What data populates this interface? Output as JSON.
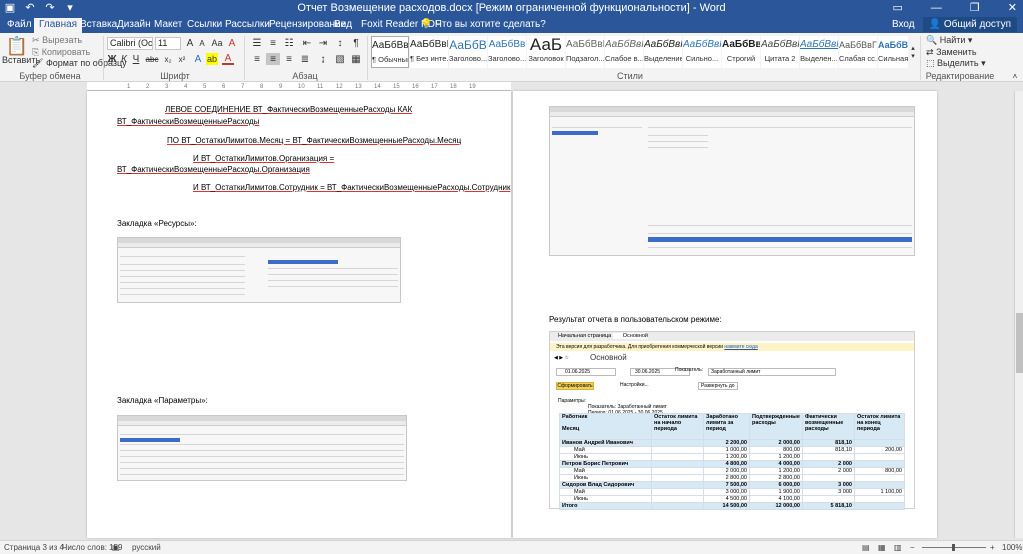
{
  "window": {
    "title": "Отчет Возмещение расходов.docx [Режим ограниченной функциональности] - Word",
    "minimize": "—",
    "restore": "❐",
    "close": "✕"
  },
  "qat": {
    "save_icon": "save-icon",
    "undo_icon": "undo-icon",
    "redo_icon": "redo-icon",
    "customize_icon": "customize-icon"
  },
  "tabs": [
    "Файл",
    "Главная",
    "Вставка",
    "Дизайн",
    "Макет",
    "Ссылки",
    "Рассылки",
    "Рецензирование",
    "Вид",
    "Foxit Reader PDF"
  ],
  "active_tab": "Главная",
  "tell_me": "Что вы хотите сделать?",
  "account": {
    "signin": "Вход",
    "share": "Общий доступ"
  },
  "ribbon": {
    "clipboard": {
      "paste": "Вставить",
      "cut": "Вырезать",
      "copy": "Копировать",
      "format_painter": "Формат по образцу",
      "label": "Буфер обмена"
    },
    "font": {
      "name": "Calibri (Осн",
      "size": "11",
      "label": "Шрифт",
      "bold": "Ж",
      "italic": "К",
      "underline": "Ч",
      "strike": "abc",
      "sub": "x₂",
      "sup": "x²",
      "grow": "A",
      "shrink": "A",
      "case": "Аа",
      "clear": "A"
    },
    "paragraph": {
      "label": "Абзац",
      "pilcrow": "¶"
    },
    "styles": {
      "label": "Стили",
      "items": [
        {
          "preview": "АаБбВвГг,",
          "name": "¶ Обычный"
        },
        {
          "preview": "АаБбВвГг,",
          "name": "¶ Без инте..."
        },
        {
          "preview": "АаБбВ",
          "name": "Заголово..."
        },
        {
          "preview": "АаБбВв",
          "name": "Заголово..."
        },
        {
          "preview": "АаБ",
          "name": "Заголовок"
        },
        {
          "preview": "АаБбВвГ",
          "name": "Подзагол..."
        },
        {
          "preview": "АаБбВвГг",
          "name": "Слабое в..."
        },
        {
          "preview": "АаБбВвГг",
          "name": "Выделение"
        },
        {
          "preview": "АаБбВвГг",
          "name": "Сильно..."
        },
        {
          "preview": "АаБбВвГг",
          "name": "Строгий"
        },
        {
          "preview": "АаБбВвГг",
          "name": "Цитата 2"
        },
        {
          "preview": "АаБбВвГг",
          "name": "Выделен..."
        },
        {
          "preview": "АаБбВвГг",
          "name": "Слабая сс..."
        },
        {
          "preview": "АаБбВвГг",
          "name": "Сильная..."
        }
      ]
    },
    "editing": {
      "find": "Найти",
      "replace": "Заменить",
      "select": "Выделить",
      "label": "Редактирование"
    }
  },
  "ruler_ticks": [
    "1",
    "2",
    "3",
    "4",
    "5",
    "6",
    "7",
    "8",
    "9",
    "10",
    "11",
    "12",
    "13",
    "14",
    "15",
    "16",
    "17",
    "18",
    "19"
  ],
  "left_page": {
    "lines": [
      "ЛЕВОЕ СОЕДИНЕНИЕ ВТ_ФактическиВозмещенныеРасходы КАК",
      "ВТ_ФактическиВозмещенныеРасходы",
      "ПО ВТ_ОстаткиЛимитов.Месяц = ВТ_ФактическиВозмещенныеРасходы.Месяц",
      "И ВТ_ОстаткиЛимитов.Организация =",
      "ВТ_ФактическиВозмещенныеРасходы.Организация",
      "И ВТ_ОстаткиЛимитов.Сотрудник = ВТ_ФактическиВозмещенныеРасходы.Сотрудник"
    ],
    "heading_resources": "Закладка «Ресурсы»:",
    "heading_params": "Закладка «Параметры»:"
  },
  "right_page": {
    "result_heading": "Результат отчета в пользовательском режиме:",
    "report": {
      "tab_home": "Начальная страница",
      "tab_main": "Основной",
      "notice": "Эта версия для разработчика. Для приобретения коммерческой версии",
      "notice_link": "нажмите сюда",
      "title": "Основной",
      "date_from": "01.06.2025",
      "date_to": "30.06.2025",
      "show_label": "Показатель:",
      "show_value": "Заработанный лимит",
      "generate_btn": "Сформировать",
      "settings_btn": "Настройки...",
      "expand_btn": "Развернуть до",
      "params_label": "Параметры:",
      "params_line1": "Показатель: Заработанный лимит",
      "params_line2": "Период: 01.06.2025 - 30.06.2025",
      "headers": [
        "Работник",
        "Остаток лимита на начало периода",
        "Заработано лимита за период",
        "Подтвержденные расходы",
        "Фактически возмещенные расходы",
        "Остаток лимита на конец периода"
      ],
      "header_sub": "Месяц",
      "rows": [
        {
          "type": "grp",
          "cells": [
            "Иванов Андрей Иванович",
            "",
            "2 200,00",
            "2 000,00",
            "818,10",
            ""
          ]
        },
        {
          "type": "row",
          "cells": [
            "Май",
            "",
            "1 000,00",
            "800,00",
            "818,10",
            "200,00"
          ]
        },
        {
          "type": "row",
          "cells": [
            "Июнь",
            "",
            "1 200,00",
            "1 200,00",
            "",
            ""
          ]
        },
        {
          "type": "grp",
          "cells": [
            "Петров Борис Петрович",
            "",
            "4 800,00",
            "4 000,00",
            "2 000",
            ""
          ]
        },
        {
          "type": "row",
          "cells": [
            "Май",
            "",
            "2 000,00",
            "1 200,00",
            "2 000",
            "800,00"
          ]
        },
        {
          "type": "row",
          "cells": [
            "Июнь",
            "",
            "2 800,00",
            "2 800,00",
            "",
            ""
          ]
        },
        {
          "type": "grp",
          "cells": [
            "Сидоров Влад Сидорович",
            "",
            "7 500,00",
            "6 000,00",
            "3 000",
            ""
          ]
        },
        {
          "type": "row",
          "cells": [
            "Май",
            "",
            "3 000,00",
            "1 900,00",
            "3 000",
            "1 100,00"
          ]
        },
        {
          "type": "row",
          "cells": [
            "Июнь",
            "",
            "4 500,00",
            "4 100,00",
            "",
            ""
          ]
        }
      ],
      "total": [
        "Итого",
        "",
        "14 500,00",
        "12 000,00",
        "5 818,10",
        ""
      ]
    }
  },
  "status": {
    "page": "Страница 3 из 4",
    "words": "Число слов: 159",
    "lang": "русский",
    "zoom": "100%"
  }
}
